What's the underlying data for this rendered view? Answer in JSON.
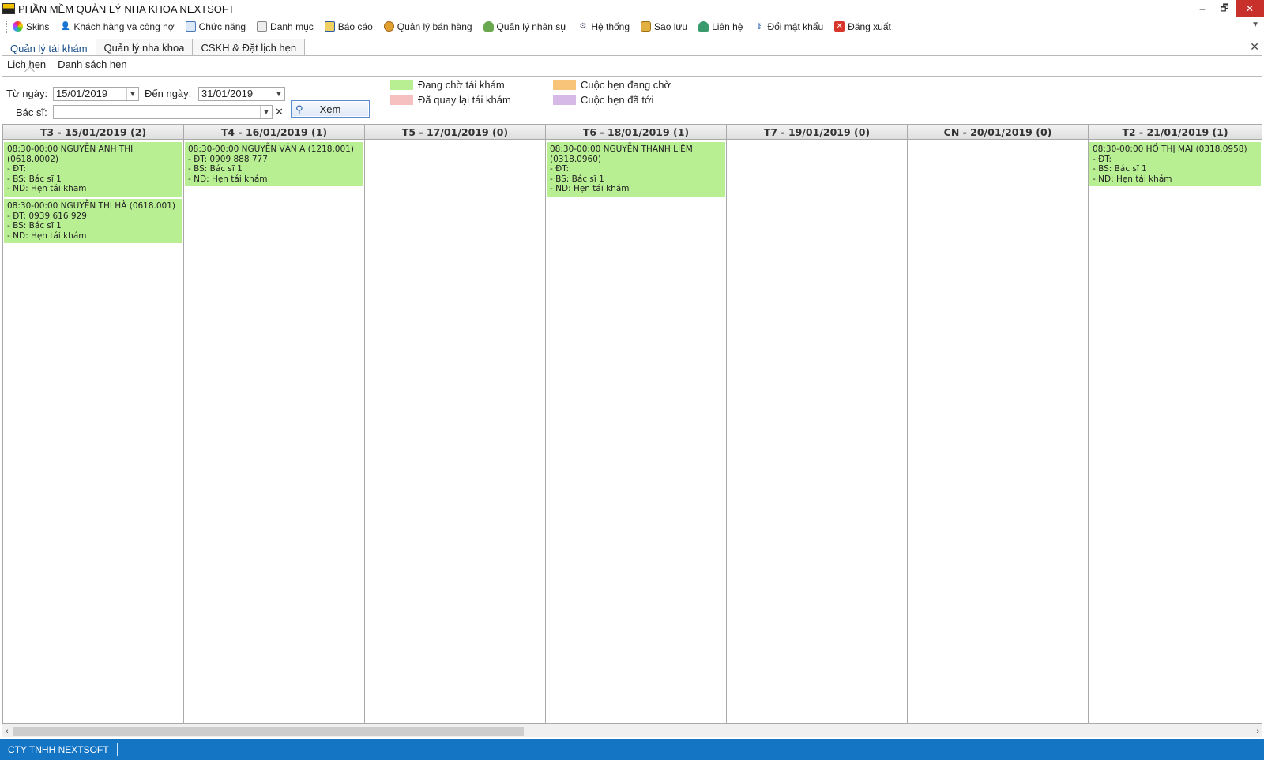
{
  "window": {
    "title": "PHẦN MỀM QUẢN LÝ NHA KHOA NEXTSOFT",
    "minimize": "–",
    "restore": "🗗",
    "close": "✕"
  },
  "menu": [
    {
      "label": "Skins",
      "icon": "skins-icon"
    },
    {
      "label": "Khách hàng và công nợ",
      "icon": "customer-icon"
    },
    {
      "label": "Chức năng",
      "icon": "function-icon"
    },
    {
      "label": "Danh mục",
      "icon": "catalog-icon"
    },
    {
      "label": "Báo cáo",
      "icon": "report-icon"
    },
    {
      "label": "Quản lý bán hàng",
      "icon": "sales-icon"
    },
    {
      "label": "Quản lý nhân sự",
      "icon": "staff-icon"
    },
    {
      "label": "Hệ thống",
      "icon": "system-icon"
    },
    {
      "label": "Sao lưu",
      "icon": "backup-icon"
    },
    {
      "label": "Liên hệ",
      "icon": "contact-icon"
    },
    {
      "label": "Đổi mật khẩu",
      "icon": "password-icon"
    },
    {
      "label": "Đăng xuất",
      "icon": "logout-icon"
    }
  ],
  "tabs": [
    "Quản lý tái khám",
    "Quản lý nha khoa",
    "CSKH & Đặt lịch hẹn"
  ],
  "subtabs": [
    "Lịch hẹn",
    "Danh sách hẹn"
  ],
  "filters": {
    "from_label": "Từ ngày:",
    "from_value": "15/01/2019",
    "to_label": "Đến ngày:",
    "to_value": "31/01/2019",
    "doctor_label": "Bác sĩ:",
    "doctor_value": "",
    "view_button": "Xem"
  },
  "legend": [
    {
      "label": "Đang chờ tái khám",
      "color": "#b9ef93"
    },
    {
      "label": "Đã quay lại tái khám",
      "color": "#f7c0c0"
    },
    {
      "label": "Cuộc hẹn đang chờ",
      "color": "#f8c47a"
    },
    {
      "label": "Cuộc hẹn đã tới",
      "color": "#d6b9e6"
    }
  ],
  "calendar": {
    "days": [
      {
        "header": "T3 - 15/01/2019 (2)",
        "appointments": [
          {
            "title": "08:30-00:00 NGUYỄN ANH THI (0618.0002)",
            "phone": "- ĐT:",
            "doctor": "- BS: Bác sĩ 1",
            "content": "- ND: Hẹn tái kham"
          },
          {
            "title": "08:30-00:00 NGUYỄN THỊ HÀ (0618.001)",
            "phone": "- ĐT: 0939 616 929",
            "doctor": "- BS: Bác sĩ 1",
            "content": "- ND: Hẹn tái khám"
          }
        ]
      },
      {
        "header": "T4 - 16/01/2019 (1)",
        "appointments": [
          {
            "title": "08:30-00:00 NGUYỄN VĂN A (1218.001)",
            "phone": "- ĐT: 0909 888 777",
            "doctor": "- BS: Bác sĩ 1",
            "content": "- ND: Hẹn tái khám"
          }
        ]
      },
      {
        "header": "T5 - 17/01/2019 (0)",
        "appointments": []
      },
      {
        "header": "T6 - 18/01/2019 (1)",
        "appointments": [
          {
            "title": "08:30-00:00 NGUYỄN THANH LIÊM (0318.0960)",
            "phone": "- ĐT:",
            "doctor": "- BS: Bác sĩ 1",
            "content": "- ND: Hẹn tái khám"
          }
        ]
      },
      {
        "header": "T7 - 19/01/2019 (0)",
        "appointments": []
      },
      {
        "header": "CN - 20/01/2019 (0)",
        "appointments": []
      },
      {
        "header": "T2 - 21/01/2019 (1)",
        "appointments": [
          {
            "title": "08:30-00:00 HỒ THỊ MAI (0318.0958)",
            "phone": "- ĐT:",
            "doctor": "- BS: Bác sĩ 1",
            "content": "- ND: Hẹn tái khám"
          }
        ]
      }
    ]
  },
  "statusbar": {
    "company": "CTY TNHH NEXTSOFT"
  }
}
